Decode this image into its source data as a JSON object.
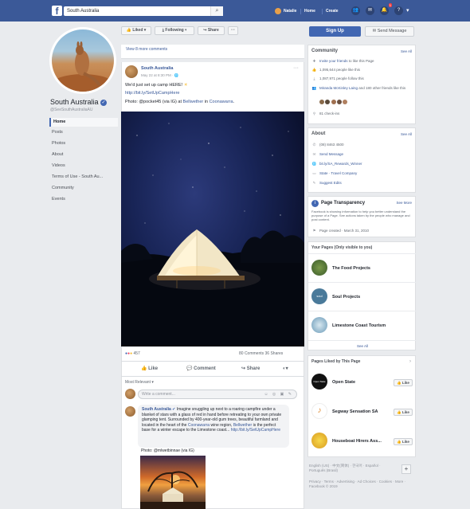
{
  "topbar": {
    "search_value": "South Australia",
    "user_name": "Natalie",
    "nav_home": "Home",
    "nav_create": "Create",
    "notif_count": "1"
  },
  "profile": {
    "name": "South Australia",
    "username": "@SeeSouthAustraliaAU",
    "nav": [
      "Home",
      "Posts",
      "Photos",
      "About",
      "Videos",
      "Terms of Use - South Au...",
      "Community",
      "Events"
    ]
  },
  "actionbar": {
    "liked": "Liked",
    "following": "Following",
    "share": "Share",
    "more": "···"
  },
  "post": {
    "view_comments": "View 8 more comments",
    "author": "South Australia",
    "date": "May 22 at 8:30 PM · ",
    "text1": "We'd just set up camp HERE!",
    "link1": "http://bit.ly/SetUpCampHere",
    "text2_prefix": "Photo: @pocket45 (via IG) at ",
    "text2_link1": "Bellwether",
    "text2_mid": " in ",
    "text2_link2": "Coonawarra",
    "text2_end": ".",
    "reactions_count": "457",
    "comments_shares": "80 Comments  36 Shares",
    "like": "Like",
    "comment": "Comment",
    "share": "Share",
    "most_relevant": "Most Relevant",
    "write_comment": "Write a comment...",
    "comment_author": "South Australia",
    "comment_text": " Imagine snuggling up next to a roaring campfire under a blanket of stars with a glass of red in hand before retreating to your own private glamping tent. Surrounded by 400-year-old gum trees, beautiful farmland and located in the heart of the ",
    "comment_link1": "Coonawarra",
    "comment_text2": " wine region, ",
    "comment_link2": "Bellwether",
    "comment_text3": " is the perfect base for a winter escape to the Limestone coast... ",
    "comment_link3": "http://bit.ly/SetUpCampHere",
    "comment_photo_credit": "Photo: @mlwetbinnae (via IG)"
  },
  "right": {
    "signup": "Sign Up",
    "send_message": "Send Message",
    "community": {
      "title": "Community",
      "see_all": "See All",
      "rows": [
        {
          "link": "Invite your friends",
          "text": " to like this Page"
        },
        {
          "link": "",
          "text": "1,095,644 people like this"
        },
        {
          "link": "",
          "text": "1,087,971 people follow this"
        },
        {
          "link": "Miranda McKinley Laing",
          "text": " and 180 other friends like this"
        },
        {
          "link": "",
          "text": "81 check-ins"
        }
      ]
    },
    "about": {
      "title": "About",
      "see_all": "See All",
      "rows": [
        "(08) 8463 4500",
        "Send Message",
        "bit.ly/SA_Rewards_Winner",
        "State · Travel Company",
        "Suggest Edits"
      ]
    },
    "transparency": {
      "title": "Page Transparency",
      "see_more": "See More",
      "text": "Facebook is showing information to help you better understand the purpose of a Page. See actions taken by the people who manage and post content.",
      "created": "Page created · March 31, 2010"
    },
    "your_pages": {
      "title": "Your Pages (Only visible to you)",
      "pages": [
        "The Food Projects",
        "Soul Projects",
        "Limestone Coast Tourism"
      ],
      "see_all": "See All"
    },
    "liked_pages": {
      "title": "Pages Liked by This Page",
      "pages": [
        "Open State",
        "Segway Sensation SA",
        "Houseboat Hirers Ass..."
      ],
      "like": "Like"
    },
    "footer": {
      "langs": "English (US) · 中文(简体) · 한국어 · Español · Português (Brasil)",
      "plus": "+",
      "links": "Privacy · Terms · Advertising · Ad Choices · Cookies · More · Facebook © 2019"
    }
  },
  "colors": {
    "brand": "#3b5998",
    "link": "#385898",
    "signup": "#4267b2"
  }
}
